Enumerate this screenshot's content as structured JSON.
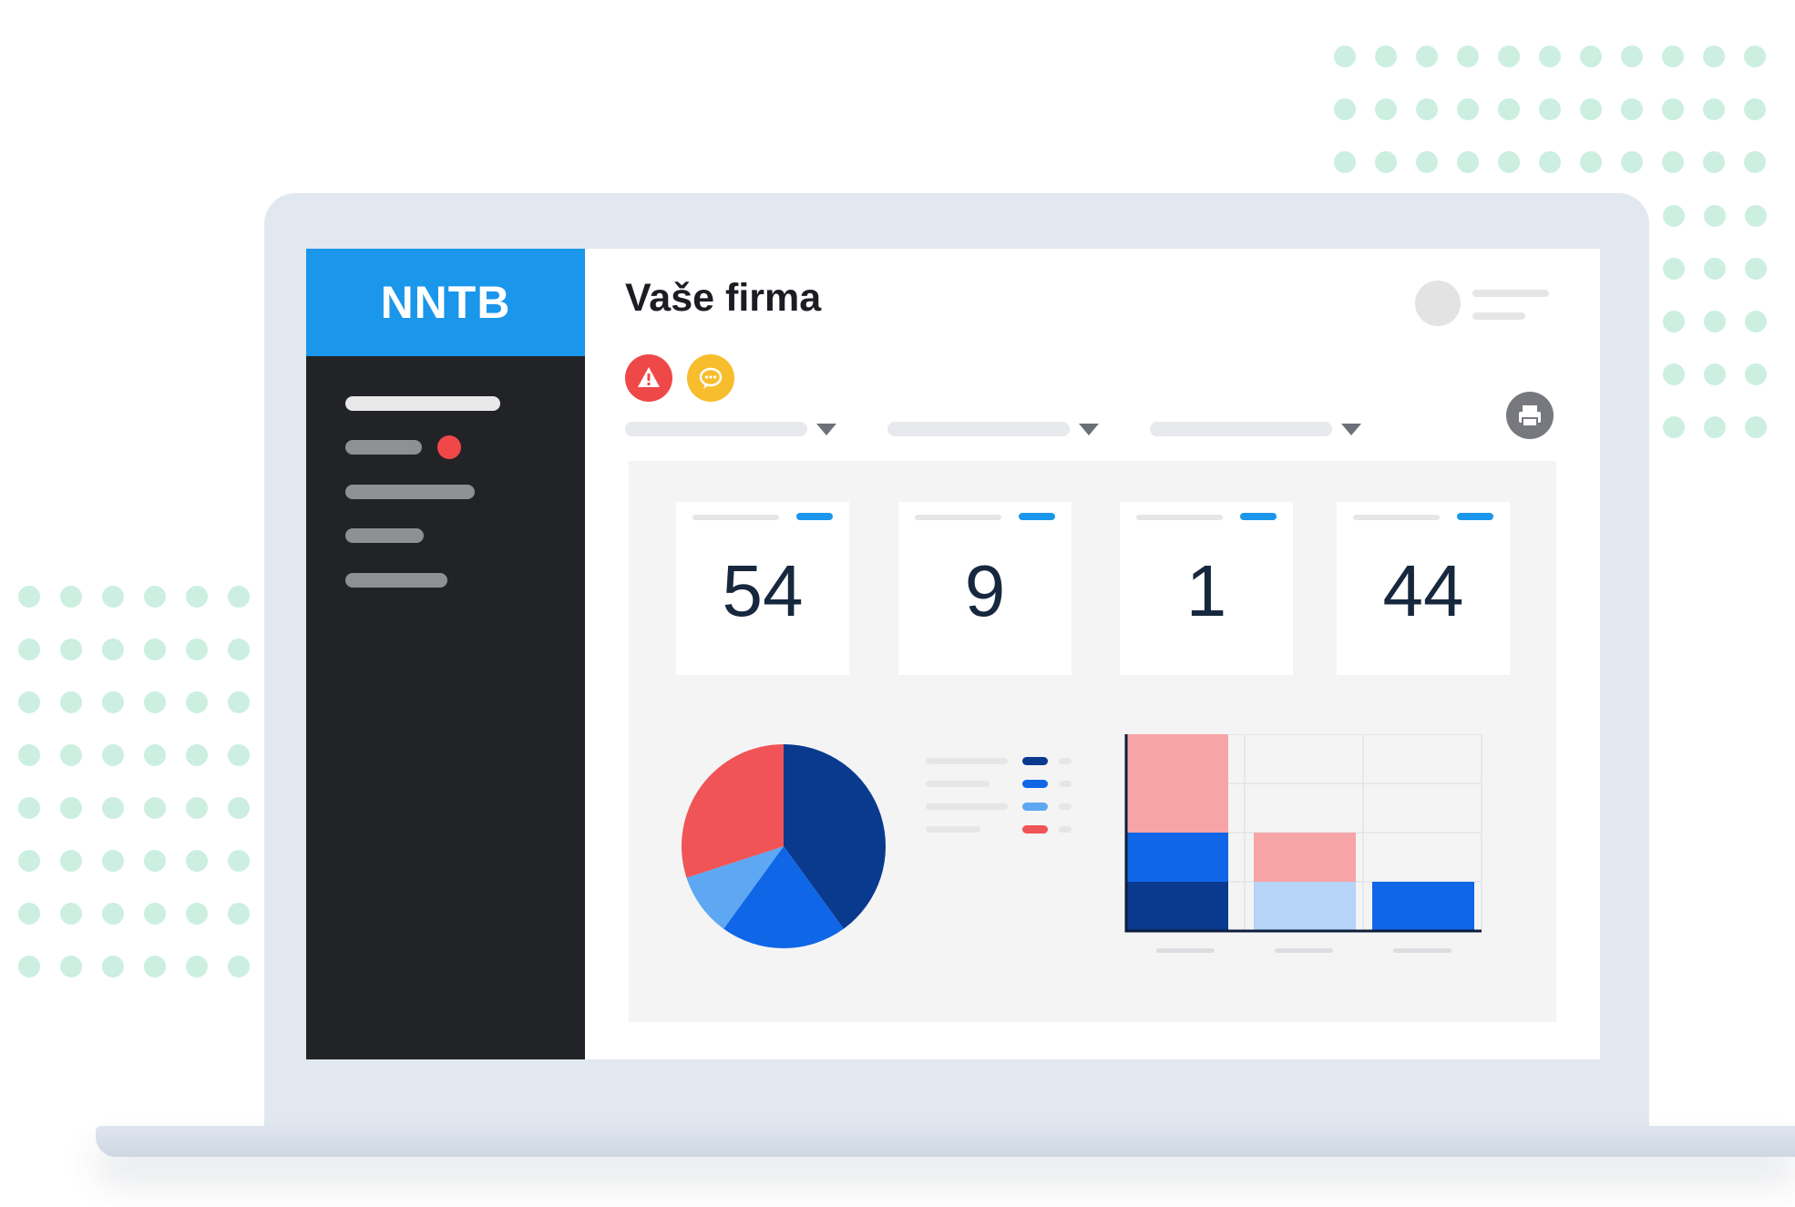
{
  "app": {
    "logo": "NNTB",
    "page_title": "Vaše firma"
  },
  "stats": [
    {
      "value": "54"
    },
    {
      "value": "9"
    },
    {
      "value": "1"
    },
    {
      "value": "44"
    }
  ],
  "icons": {
    "alert": "warning-icon",
    "message": "chat-icon",
    "print": "printer-icon",
    "filter_caret": "chevron-down-icon"
  },
  "colors": {
    "brand_blue": "#1a96ea",
    "sidebar": "#222326",
    "alert_red": "#ef4848",
    "message_yellow": "#f7bd2c",
    "navy": "#0a3a8e",
    "blue": "#0f66e6",
    "light_blue": "#5ea7f2",
    "red": "#f05456",
    "pink": "#f7a4a6",
    "pale_blue": "#b5d4f8"
  },
  "chart_data": [
    {
      "type": "pie",
      "values": [
        40,
        20,
        10,
        30
      ],
      "colors": [
        "#0a3a8e",
        "#0f66e6",
        "#5ea7f2",
        "#f05456"
      ]
    },
    {
      "type": "bar",
      "stacked": true,
      "categories": [
        "",
        "",
        ""
      ],
      "series": [
        {
          "values": [
            1,
            0,
            0
          ],
          "color": "#0a3a8e"
        },
        {
          "values": [
            1,
            0,
            1
          ],
          "color": "#0f66e6"
        },
        {
          "values": [
            0,
            1,
            0
          ],
          "color": "#b5d4f8"
        },
        {
          "values": [
            2,
            1,
            0
          ],
          "color": "#f7a4a6"
        }
      ],
      "ylim": [
        0,
        4
      ],
      "grid": true
    }
  ]
}
